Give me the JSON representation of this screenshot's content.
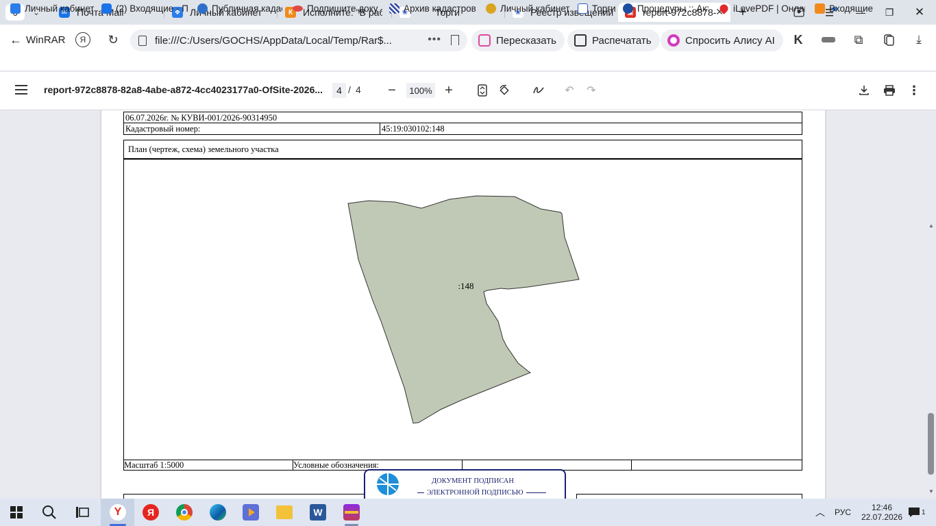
{
  "browser": {
    "tab_count": "6",
    "tabs": [
      {
        "title": "Почта Mail"
      },
      {
        "title": "Личный кабинет"
      },
      {
        "title": "Исполните: \"В рабо"
      },
      {
        "title": "Торги"
      },
      {
        "title": "Реестр извещений"
      },
      {
        "title": "report-972c8878-"
      }
    ],
    "back_label": "WinRAR",
    "url": "file:///C:/Users/GOCHS/AppData/Local/Temp/Rar$...",
    "actions": {
      "retell": "Пересказать",
      "print": "Распечатать",
      "ask_alice": "Спросить Алису AI"
    },
    "bookmarks": [
      "Личный кабинет",
      "(2) Входящие - По",
      "Публичная кадас",
      "Подпишите доку",
      "Архив кадастров",
      "Личный кабинет",
      "Торги",
      "Процедуры :: Акт",
      "iLovePDF | Онлай",
      "Входящие"
    ]
  },
  "pdf": {
    "title": "report-972c8878-82a8-4abe-a872-4cc4023177a0-OfSite-2026...",
    "page_current": "4",
    "page_separator": "/",
    "page_total": "4",
    "zoom": "100%"
  },
  "document": {
    "header_line": "06.07.2026г. № КУВИ-001/2026-90314950",
    "cadastral_label": "Кадастровый номер:",
    "cadastral_value": "45:19:030102:148",
    "plan_title": "План (чертеж, схема) земельного участка",
    "parcel_label": ":148",
    "scale": "Масштаб 1:5000",
    "legend_label": "Условные обозначения:",
    "stamp_line1": "ДОКУМЕНТ ПОДПИСАН",
    "stamp_line2": "ЭЛЕКТРОННОЙ ПОДПИСЬЮ"
  },
  "taskbar": {
    "lang": "РУС",
    "time": "12:46",
    "date": "22.07.2026",
    "notifications": "1"
  },
  "colors": {
    "parcel_fill": "#c0c9b5",
    "active_tab_favicon": "#d93025",
    "stamp": "#1a1f6e"
  }
}
